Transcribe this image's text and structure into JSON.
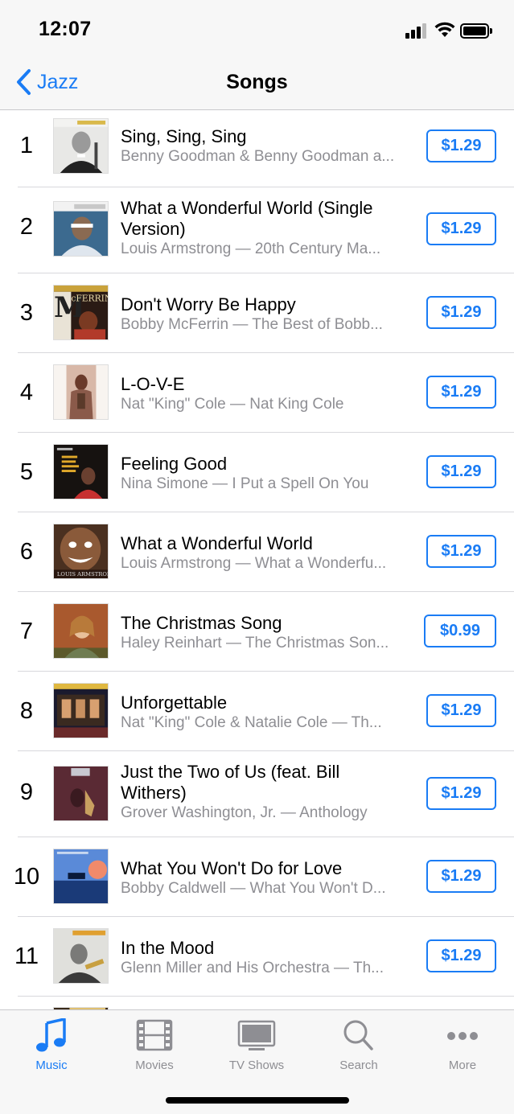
{
  "status_bar": {
    "time": "12:07"
  },
  "nav": {
    "back_label": "Jazz",
    "title": "Songs"
  },
  "colors": {
    "accent": "#1a7cf5",
    "secondary_text": "#8e8e93"
  },
  "songs": [
    {
      "rank": "1",
      "title": "Sing, Sing, Sing",
      "subtitle": "Benny Goodman & Benny Goodman a...",
      "price": "$1.29"
    },
    {
      "rank": "2",
      "title": "What a Wonderful World (Single Version)",
      "subtitle": "Louis Armstrong — 20th Century Ma...",
      "price": "$1.29"
    },
    {
      "rank": "3",
      "title": "Don't Worry Be Happy",
      "subtitle": "Bobby McFerrin — The Best of Bobb...",
      "price": "$1.29"
    },
    {
      "rank": "4",
      "title": "L-O-V-E",
      "subtitle": "Nat \"King\" Cole — Nat King Cole",
      "price": "$1.29"
    },
    {
      "rank": "5",
      "title": "Feeling Good",
      "subtitle": "Nina Simone — I Put a Spell On You",
      "price": "$1.29"
    },
    {
      "rank": "6",
      "title": "What a Wonderful World",
      "subtitle": "Louis Armstrong — What a Wonderfu...",
      "price": "$1.29"
    },
    {
      "rank": "7",
      "title": "The Christmas Song",
      "subtitle": "Haley Reinhart — The Christmas Son...",
      "price": "$0.99"
    },
    {
      "rank": "8",
      "title": "Unforgettable",
      "subtitle": "Nat \"King\" Cole & Natalie Cole — Th...",
      "price": "$1.29"
    },
    {
      "rank": "9",
      "title": "Just the Two of Us (feat. Bill Withers)",
      "subtitle": "Grover Washington, Jr. — Anthology",
      "price": "$1.29"
    },
    {
      "rank": "10",
      "title": "What You Won't Do for Love",
      "subtitle": "Bobby Caldwell — What You Won't D...",
      "price": "$1.29"
    },
    {
      "rank": "11",
      "title": "In the Mood",
      "subtitle": "Glenn Miller and His Orchestra — Th...",
      "price": "$1.29"
    }
  ],
  "tabs": [
    {
      "label": "Music",
      "icon": "music-note-icon",
      "active": true
    },
    {
      "label": "Movies",
      "icon": "film-icon",
      "active": false
    },
    {
      "label": "TV Shows",
      "icon": "tv-icon",
      "active": false
    },
    {
      "label": "Search",
      "icon": "search-icon",
      "active": false
    },
    {
      "label": "More",
      "icon": "more-icon",
      "active": false
    }
  ]
}
